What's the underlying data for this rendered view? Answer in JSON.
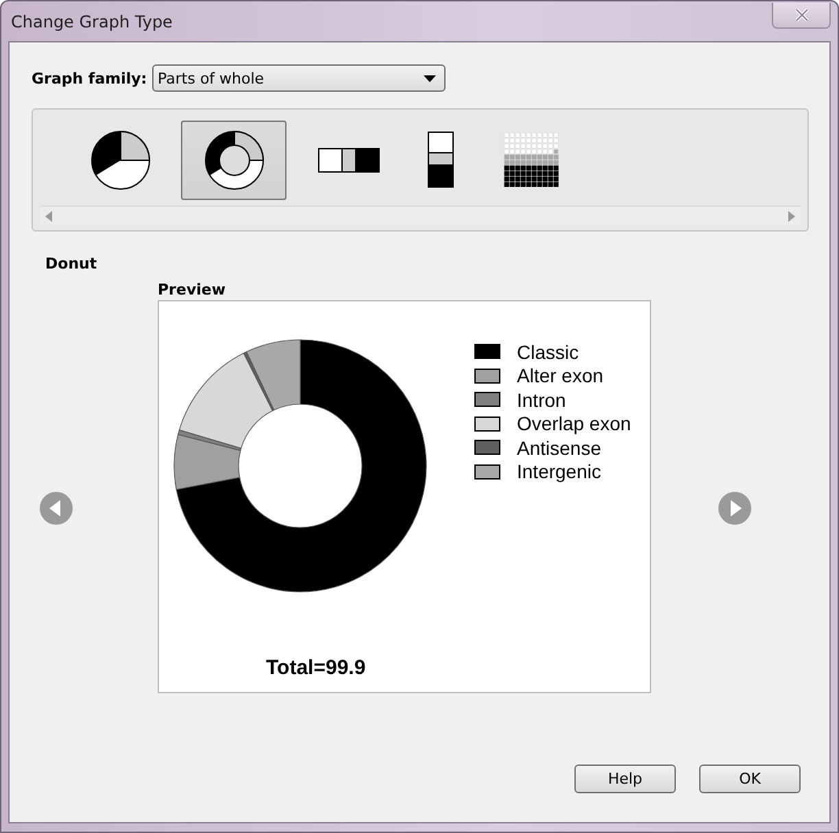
{
  "window": {
    "title": "Change Graph Type"
  },
  "graph_family": {
    "label": "Graph family:",
    "value": "Parts of whole"
  },
  "gallery": [
    {
      "kind": "pie",
      "selected": false
    },
    {
      "kind": "donut",
      "selected": true
    },
    {
      "kind": "hbar",
      "selected": false
    },
    {
      "kind": "vbar",
      "selected": false
    },
    {
      "kind": "waffle",
      "selected": false
    }
  ],
  "selected_type_name": "Donut",
  "preview": {
    "title": "Preview",
    "total": "Total=99.9",
    "legend": [
      {
        "label": "Classic",
        "color": "#000000"
      },
      {
        "label": "Alter exon",
        "color": "#a0a0a0"
      },
      {
        "label": "Intron",
        "color": "#808080"
      },
      {
        "label": "Overlap exon",
        "color": "#d8d8d8"
      },
      {
        "label": "Antisense",
        "color": "#606060"
      },
      {
        "label": "Intergenic",
        "color": "#a8a8a8"
      }
    ]
  },
  "buttons": [
    "Help",
    "OK"
  ]
}
